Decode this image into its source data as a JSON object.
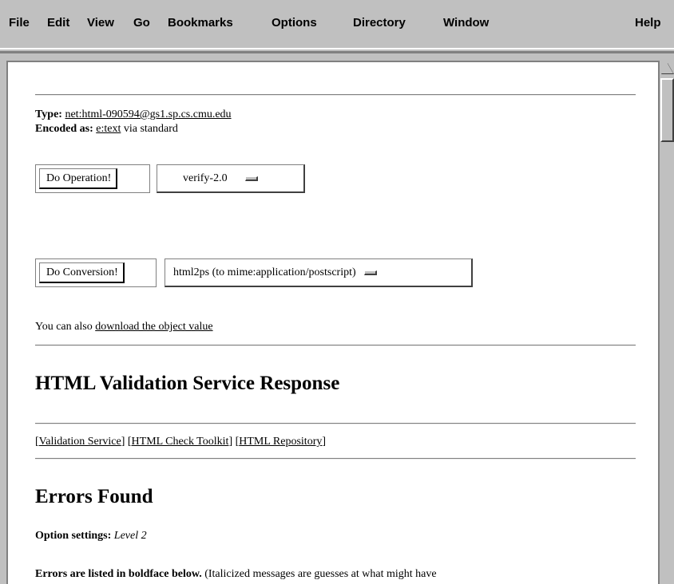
{
  "menubar": {
    "items": [
      "File",
      "Edit",
      "View",
      "Go",
      "Bookmarks",
      "Options",
      "Directory",
      "Window"
    ],
    "help": "Help"
  },
  "header": {
    "type_label": "Type:",
    "type_value": "net:html-090594@gs1.sp.cs.cmu.edu",
    "encoded_label": "Encoded as:",
    "encoded_value": "e:text",
    "encoded_suffix": " via standard"
  },
  "operation": {
    "button_label": "Do Operation!",
    "selected": "verify-2.0"
  },
  "conversion": {
    "button_label": "Do Conversion!",
    "selected": "html2ps (to mime:application/postscript)"
  },
  "download": {
    "prefix": "You can also ",
    "link": "download the object value"
  },
  "response_title": "HTML Validation Service Response",
  "nav_links": {
    "open1": "[",
    "validation_service": "Validation Service",
    "mid1": "] [",
    "html_check_toolkit": "HTML Check Toolkit",
    "mid2": "] [",
    "html_repository": "HTML Repository",
    "close": "]"
  },
  "errors": {
    "title": "Errors Found",
    "option_label": "Option settings:",
    "option_value": " Level 2",
    "listed_bold": "Errors are listed in boldface below.",
    "listed_rest": " (Italicized messages are guesses at what might have"
  }
}
